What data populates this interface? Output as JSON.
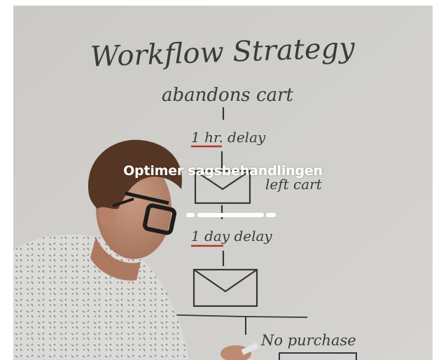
{
  "hero": {
    "headline": "Optimer sagsbehandlingen",
    "whiteboard": {
      "title": "Workflow Strategy",
      "step1": "abandons cart",
      "step2": "1 hr. delay",
      "step3": "left cart",
      "step4": "1 day delay",
      "step5": "No purchase"
    },
    "colors": {
      "board": "#dcdad6",
      "ink": "#3a3a3a",
      "underline": "#c0392b",
      "headline": "#ffffff"
    }
  }
}
